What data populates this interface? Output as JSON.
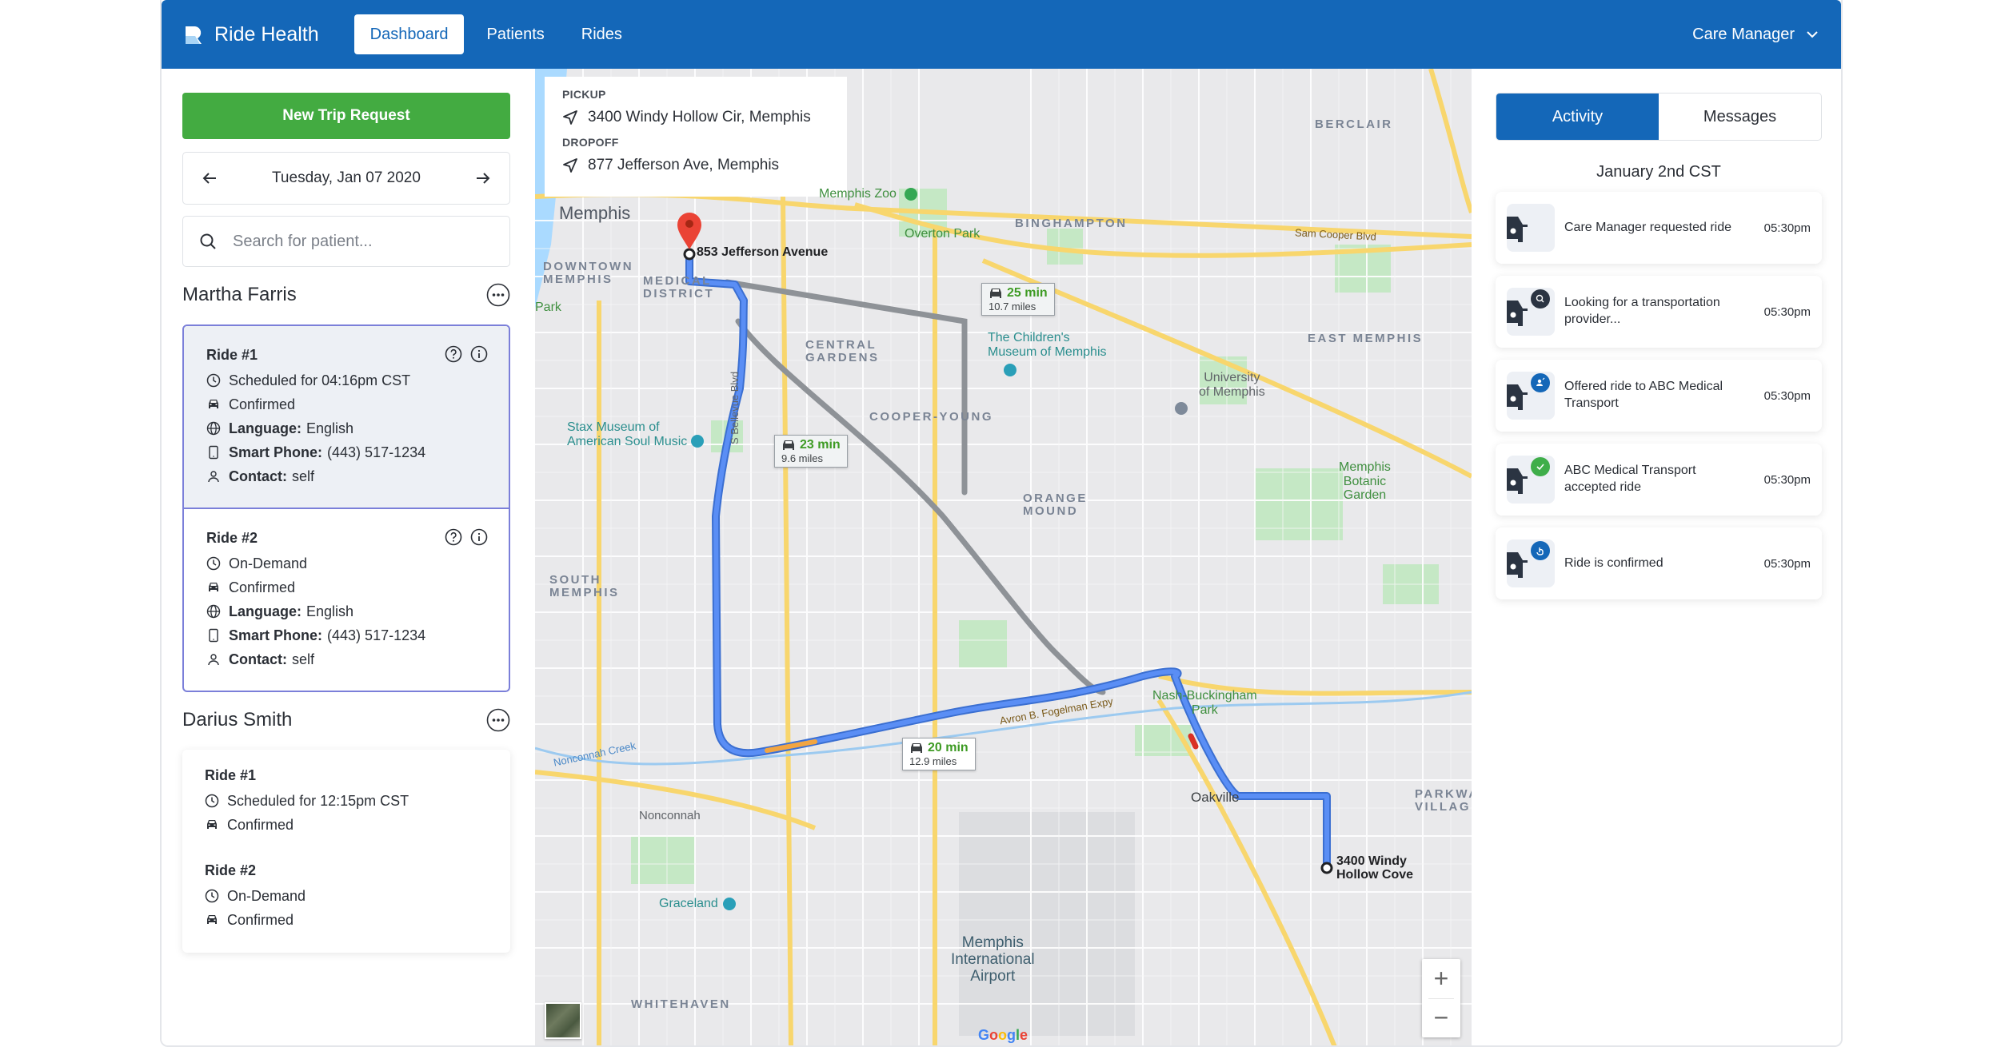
{
  "header": {
    "brand": "Ride Health",
    "nav": [
      {
        "label": "Dashboard",
        "active": true
      },
      {
        "label": "Patients",
        "active": false
      },
      {
        "label": "Rides",
        "active": false
      }
    ],
    "user_menu": "Care Manager"
  },
  "sidebar": {
    "new_trip_label": "New Trip Request",
    "date": "Tuesday, Jan 07 2020",
    "search_placeholder": "Search for patient...",
    "patients": [
      {
        "name": "Martha Farris",
        "rides": [
          {
            "title": "Ride #1",
            "schedule": "Scheduled for 04:16pm CST",
            "status": "Confirmed",
            "language_label": "Language:",
            "language": "English",
            "phone_label": "Smart Phone:",
            "phone": "(443) 517-1234",
            "contact_label": "Contact:",
            "contact": "self"
          },
          {
            "title": "Ride #2",
            "schedule": "On-Demand",
            "status": "Confirmed",
            "language_label": "Language:",
            "language": "English",
            "phone_label": "Smart Phone:",
            "phone": "(443) 517-1234",
            "contact_label": "Contact:",
            "contact": "self"
          }
        ]
      },
      {
        "name": "Darius Smith",
        "rides": [
          {
            "title": "Ride #1",
            "schedule": "Scheduled for 12:15pm CST",
            "status": "Confirmed"
          },
          {
            "title": "Ride #2",
            "schedule": "On-Demand",
            "status": "Confirmed"
          }
        ]
      }
    ]
  },
  "map": {
    "pickup_label": "PICKUP",
    "pickup_address": "3400 Windy Hollow Cir, Memphis",
    "dropoff_label": "DROPOFF",
    "dropoff_address": "877 Jefferson Ave, Memphis",
    "destination_marker": "853 Jefferson Avenue",
    "origin_marker": "3400 Windy Hollow Cove",
    "routes": [
      {
        "time": "20 min",
        "distance": "12.9 miles",
        "selected": true
      },
      {
        "time": "23 min",
        "distance": "9.6 miles",
        "selected": false
      },
      {
        "time": "25 min",
        "distance": "10.7 miles",
        "selected": false
      }
    ],
    "labels": {
      "city": "Memphis",
      "downtown": "DOWNTOWN\nMEMPHIS",
      "medical": "MEDICAL\nDISTRICT",
      "central_gardens": "CENTRAL\nGARDENS",
      "cooper_young": "COOPER-YOUNG",
      "binghampton": "BINGHAMPTON",
      "berclair": "BERCLAIR",
      "east_memphis": "EAST MEMPHIS",
      "orange_mound": "ORANGE\nMOUND",
      "south_memphis": "SOUTH\nMEMPHIS",
      "parkway_village": "PARKWAY\nVILLAGE",
      "whitehaven": "WHITEHAVEN",
      "nonconnah": "Nonconnah",
      "oakville": "Oakville",
      "zoo": "Memphis Zoo",
      "overton": "Overton Park",
      "childrens_museum": "The Children's\nMuseum of Memphis",
      "stax": "Stax Museum of\nAmerican Soul Music",
      "university": "University\nof Memphis",
      "botanic": "Memphis\nBotanic\nGarden",
      "nash": "Nash-Buckingham\nPark",
      "graceland": "Graceland",
      "airport": "Memphis\nInternational\nAirport",
      "park": "Park",
      "sam_cooper": "Sam Cooper Blvd",
      "fogelman": "Avron B. Fogelman Expy",
      "bellevue": "S Bellevue Blvd",
      "creek": "Nonconnah Creek"
    },
    "zoom_in": "+",
    "zoom_out": "−",
    "attribution": "Google"
  },
  "activity": {
    "tabs": [
      {
        "label": "Activity",
        "active": true
      },
      {
        "label": "Messages",
        "active": false
      }
    ],
    "date": "January 2nd CST",
    "items": [
      {
        "text": "Care Manager requested ride",
        "time": "05:30pm",
        "badge": "none"
      },
      {
        "text": "Looking for a transportation provider...",
        "time": "05:30pm",
        "badge": "search"
      },
      {
        "text": "Offered ride to ABC Medical Transport",
        "time": "05:30pm",
        "badge": "offer"
      },
      {
        "text": "ABC Medical Transport accepted ride",
        "time": "05:30pm",
        "badge": "check"
      },
      {
        "text": "Ride is confirmed",
        "time": "05:30pm",
        "badge": "confirm"
      }
    ],
    "badge_colors": {
      "search": "#2b3442",
      "offer": "#1467b8",
      "check": "#3fae4a",
      "confirm": "#1467b8"
    }
  },
  "colors": {
    "brand": "#1467b8",
    "primary_action": "#43ab41",
    "selected_border": "#7b7fd9",
    "route_selected": "#4a7fe8",
    "route_alt": "#9aa0a6"
  }
}
